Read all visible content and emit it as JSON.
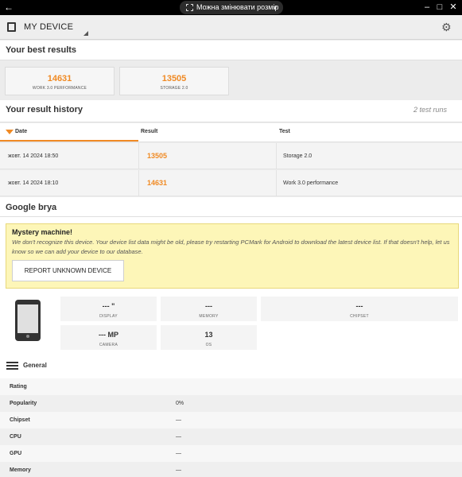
{
  "window": {
    "resize_label": "Можна змінювати розмір",
    "controls": [
      "–",
      "□",
      "✕"
    ]
  },
  "app": {
    "title": "MY DEVICE"
  },
  "best_results": {
    "title": "Your best results",
    "cards": [
      {
        "value": "14631",
        "label": "WORK 3.0 PERFORMANCE"
      },
      {
        "value": "13505",
        "label": "STORAGE 2.0"
      }
    ]
  },
  "history": {
    "title": "Your result history",
    "count": "2 test runs",
    "columns": [
      "Date",
      "Result",
      "Test"
    ],
    "rows": [
      {
        "date": "жовт. 14 2024 18:50",
        "result": "13505",
        "test": "Storage 2.0"
      },
      {
        "date": "жовт. 14 2024 18:10",
        "result": "14631",
        "test": "Work 3.0 performance"
      }
    ]
  },
  "device": {
    "title": "Google brya",
    "notice_title": "Mystery machine!",
    "notice_text": "We don't recognize this device. Your device list data might be old, please try restarting PCMark for Android to download the latest device list. If that doesn't help, let us know so we can add your device to our database.",
    "report_button": "REPORT UNKNOWN DEVICE",
    "specs": [
      {
        "value": "--- \"",
        "label": "DISPLAY"
      },
      {
        "value": "---",
        "label": "MEMORY"
      },
      {
        "value": "---",
        "label": "CHIPSET"
      },
      {
        "value": "--- MP",
        "label": "CAMERA"
      },
      {
        "value": "13",
        "label": "OS"
      }
    ]
  },
  "general": {
    "title": "General",
    "rows": [
      {
        "key": "Rating",
        "value": ""
      },
      {
        "key": "Popularity",
        "value": "0%"
      },
      {
        "key": "Chipset",
        "value": "—"
      },
      {
        "key": "CPU",
        "value": "—"
      },
      {
        "key": "GPU",
        "value": "—"
      },
      {
        "key": "Memory",
        "value": "—"
      }
    ]
  }
}
